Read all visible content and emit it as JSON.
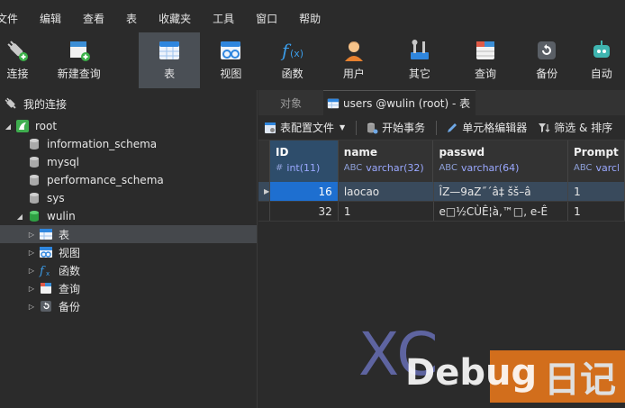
{
  "menubar": [
    "文件",
    "编辑",
    "查看",
    "表",
    "收藏夹",
    "工具",
    "窗口",
    "帮助"
  ],
  "toolbar": {
    "items": [
      {
        "label": "连接",
        "icon": "plug-icon"
      },
      {
        "label": "新建查询",
        "icon": "new-query-icon"
      },
      {
        "label": "表",
        "icon": "table-icon",
        "active": true
      },
      {
        "label": "视图",
        "icon": "view-icon"
      },
      {
        "label": "函数",
        "icon": "function-icon"
      },
      {
        "label": "用户",
        "icon": "user-icon"
      },
      {
        "label": "其它",
        "icon": "tools-icon"
      },
      {
        "label": "查询",
        "icon": "query-icon"
      },
      {
        "label": "备份",
        "icon": "backup-icon"
      },
      {
        "label": "自动",
        "icon": "robot-icon"
      }
    ]
  },
  "left": {
    "header": "我的连接",
    "tree": [
      {
        "label": "root",
        "level": 0,
        "expanded": true
      },
      {
        "label": "information_schema",
        "level": 1
      },
      {
        "label": "mysql",
        "level": 1
      },
      {
        "label": "performance_schema",
        "level": 1
      },
      {
        "label": "sys",
        "level": 1
      },
      {
        "label": "wulin",
        "level": 1,
        "expanded": true
      },
      {
        "label": "表",
        "level": 2,
        "selected": true
      },
      {
        "label": "视图",
        "level": 2
      },
      {
        "label": "函数",
        "level": 2
      },
      {
        "label": "查询",
        "level": 2
      },
      {
        "label": "备份",
        "level": 2
      }
    ]
  },
  "tabs": {
    "objects": "对象",
    "active": "users @wulin (root) - 表"
  },
  "subtoolbar": {
    "table_config": "表配置文件",
    "begin_tx": "开始事务",
    "cell_editor": "单元格编辑器",
    "filter_sort": "筛选 & 排序"
  },
  "grid": {
    "columns": [
      {
        "name": "ID",
        "type": "int(11)",
        "type_prefix": "#"
      },
      {
        "name": "name",
        "type": "varchar(32)",
        "type_prefix": "ABC"
      },
      {
        "name": "passwd",
        "type": "varchar(64)",
        "type_prefix": "ABC"
      },
      {
        "name": "Prompt",
        "type": "varcha",
        "type_prefix": "ABC"
      }
    ],
    "rows": [
      {
        "id": "16",
        "name": "laocao",
        "passwd": "ÎZ—9aZ˝ˊâ‡ šš–â",
        "prompt": "1"
      },
      {
        "id": "32",
        "name": "1",
        "passwd": "e□½CÙÊ¦à,™□, e-Ê",
        "prompt": "1"
      }
    ]
  },
  "watermark": {
    "xc": "XC",
    "debug": "Debug",
    "riji": "日记"
  },
  "colors": {
    "accent": "#1e6fd0",
    "watermark_orange": "#f07a1a"
  }
}
